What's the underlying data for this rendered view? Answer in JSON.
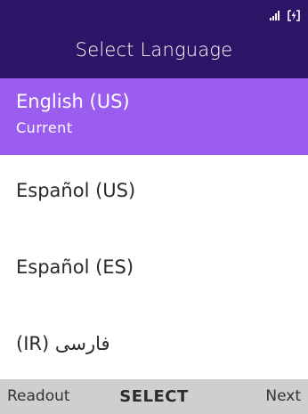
{
  "header": {
    "title": "Select Language",
    "status": {
      "signal_icon": "signal-bars-icon",
      "battery_icon": "battery-charging-icon"
    }
  },
  "languages": [
    {
      "label": "English (US)",
      "sublabel": "Current",
      "selected": true
    },
    {
      "label": "Español (US)",
      "selected": false
    },
    {
      "label": "Español (ES)",
      "selected": false
    },
    {
      "label": "فارسی (IR)",
      "selected": false
    }
  ],
  "softkeys": {
    "left": "Readout",
    "center": "SELECT",
    "right": "Next"
  },
  "colors": {
    "header_bg": "#2e1466",
    "selected_bg": "#9b5cf0",
    "softkey_bg": "#cfcfcf"
  }
}
